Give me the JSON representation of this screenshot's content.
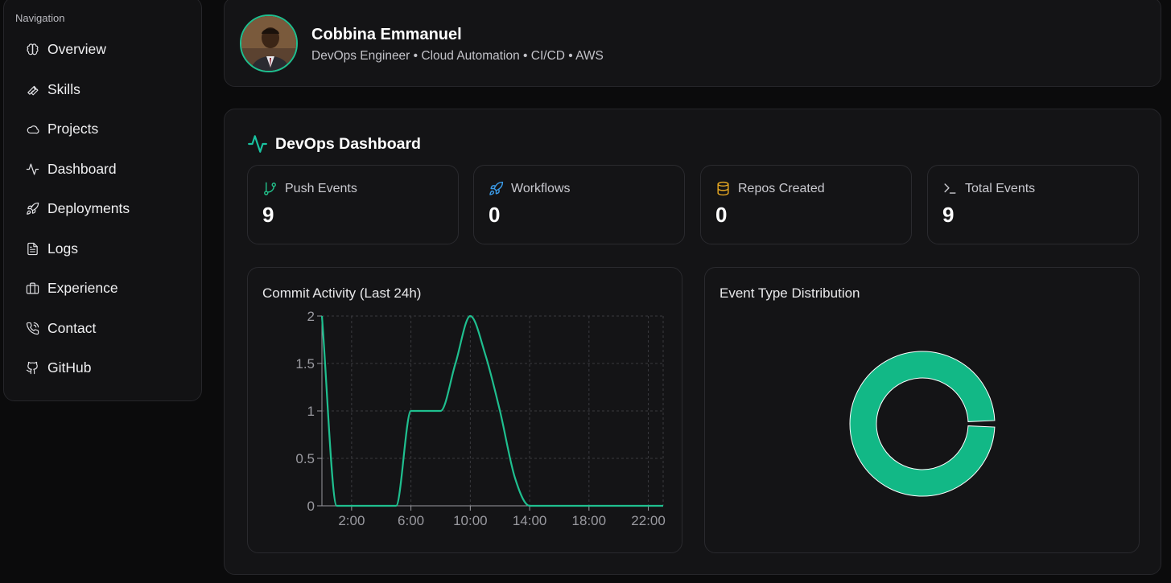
{
  "sidebar": {
    "heading": "Navigation",
    "items": [
      {
        "label": "Overview",
        "icon": "brain-icon"
      },
      {
        "label": "Skills",
        "icon": "wrench-icon"
      },
      {
        "label": "Projects",
        "icon": "cloud-icon"
      },
      {
        "label": "Dashboard",
        "icon": "activity-icon"
      },
      {
        "label": "Deployments",
        "icon": "rocket-icon"
      },
      {
        "label": "Logs",
        "icon": "file-text-icon"
      },
      {
        "label": "Experience",
        "icon": "briefcase-icon"
      },
      {
        "label": "Contact",
        "icon": "phone-icon"
      },
      {
        "label": "GitHub",
        "icon": "github-icon"
      }
    ]
  },
  "profile": {
    "name": "Cobbina Emmanuel",
    "subtitle": "DevOps Engineer • Cloud Automation • CI/CD • AWS",
    "accent": "#1fbf8f"
  },
  "dashboard": {
    "title": "DevOps Dashboard",
    "stats": [
      {
        "label": "Push Events",
        "value": "9",
        "icon": "git-branch-icon",
        "color": "#22c08a"
      },
      {
        "label": "Workflows",
        "value": "0",
        "icon": "rocket-icon",
        "color": "#3b9be8"
      },
      {
        "label": "Repos Created",
        "value": "0",
        "icon": "database-icon",
        "color": "#e8a923"
      },
      {
        "label": "Total Events",
        "value": "9",
        "icon": "terminal-icon",
        "color": "#c9c9cf"
      }
    ]
  },
  "chart_data": [
    {
      "type": "line",
      "title": "Commit Activity (Last 24h)",
      "x": [
        0,
        1,
        2,
        3,
        4,
        5,
        6,
        7,
        8,
        9,
        10,
        11,
        12,
        13,
        14,
        15,
        16,
        17,
        18,
        19,
        20,
        21,
        22,
        23
      ],
      "y": [
        2,
        0,
        0,
        0,
        0,
        0,
        1,
        1,
        1,
        1.5,
        2,
        1.6,
        1,
        0.3,
        0,
        0,
        0,
        0,
        0,
        0,
        0,
        0,
        0,
        0
      ],
      "x_tick_labels": [
        "2:00",
        "6:00",
        "10:00",
        "14:00",
        "18:00",
        "22:00"
      ],
      "y_tick_labels": [
        "0",
        "0.5",
        "1",
        "1.5",
        "2"
      ],
      "ylim": [
        0,
        2
      ],
      "grid": true,
      "color": "#1fbf8f"
    },
    {
      "type": "pie",
      "title": "Event Type Distribution",
      "slices": [
        {
          "value": 9,
          "color": "#12b886"
        }
      ],
      "donut": true
    }
  ]
}
